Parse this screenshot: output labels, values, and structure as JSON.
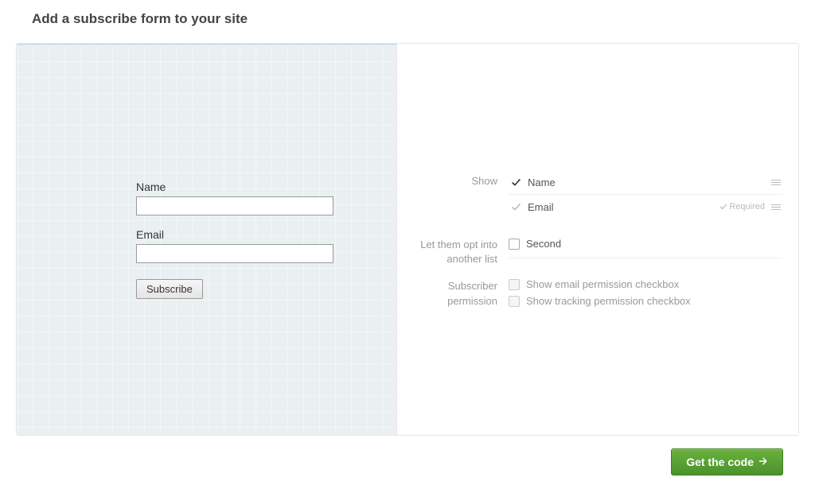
{
  "page": {
    "title": "Add a subscribe form to your site"
  },
  "preview": {
    "name_label": "Name",
    "email_label": "Email",
    "subscribe_label": "Subscribe"
  },
  "settings": {
    "show_label": "Show",
    "fields": [
      {
        "label": "Name",
        "checked": true,
        "locked": false,
        "required": false
      },
      {
        "label": "Email",
        "checked": true,
        "locked": true,
        "required": true
      }
    ],
    "required_tag": "Required",
    "opt_label": "Let them opt into another list",
    "opt_items": [
      {
        "label": "Second",
        "checked": false
      }
    ],
    "permission_label": "Subscriber permission",
    "permission_items": [
      {
        "label": "Show email permission checkbox",
        "checked": false
      },
      {
        "label": "Show tracking permission checkbox",
        "checked": false
      }
    ]
  },
  "footer": {
    "getcode_label": "Get the code"
  }
}
